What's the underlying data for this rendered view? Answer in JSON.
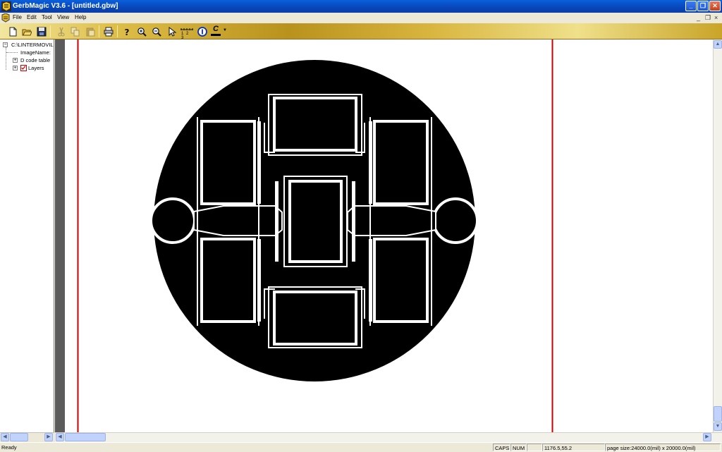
{
  "window": {
    "title": "GerbMagic V3.6 - [untitled.gbw]",
    "minimize": "_",
    "restore": "❐",
    "close": "✕"
  },
  "menu": {
    "items": [
      "File",
      "Edit",
      "Tool",
      "View",
      "Help"
    ],
    "mdi_minimize": "_",
    "mdi_restore": "❐",
    "mdi_close": "×"
  },
  "toolbar": {
    "ruler_label": "1 2 3",
    "color_label": "C"
  },
  "tree": {
    "root": "C:\\LINTERMOVIL",
    "image_name": "ImageName:",
    "dcode_table": "D code table",
    "layers": "Layers"
  },
  "status": {
    "ready": "Ready",
    "caps": "CAPS",
    "num": "NUM",
    "coords": "1176.5,55.2",
    "page_size": "page size:24000.0(mil) x 20000.0(mil)"
  },
  "colors": {
    "border_lines": "#cc0000",
    "board": "#000000",
    "background": "#ffffff"
  }
}
